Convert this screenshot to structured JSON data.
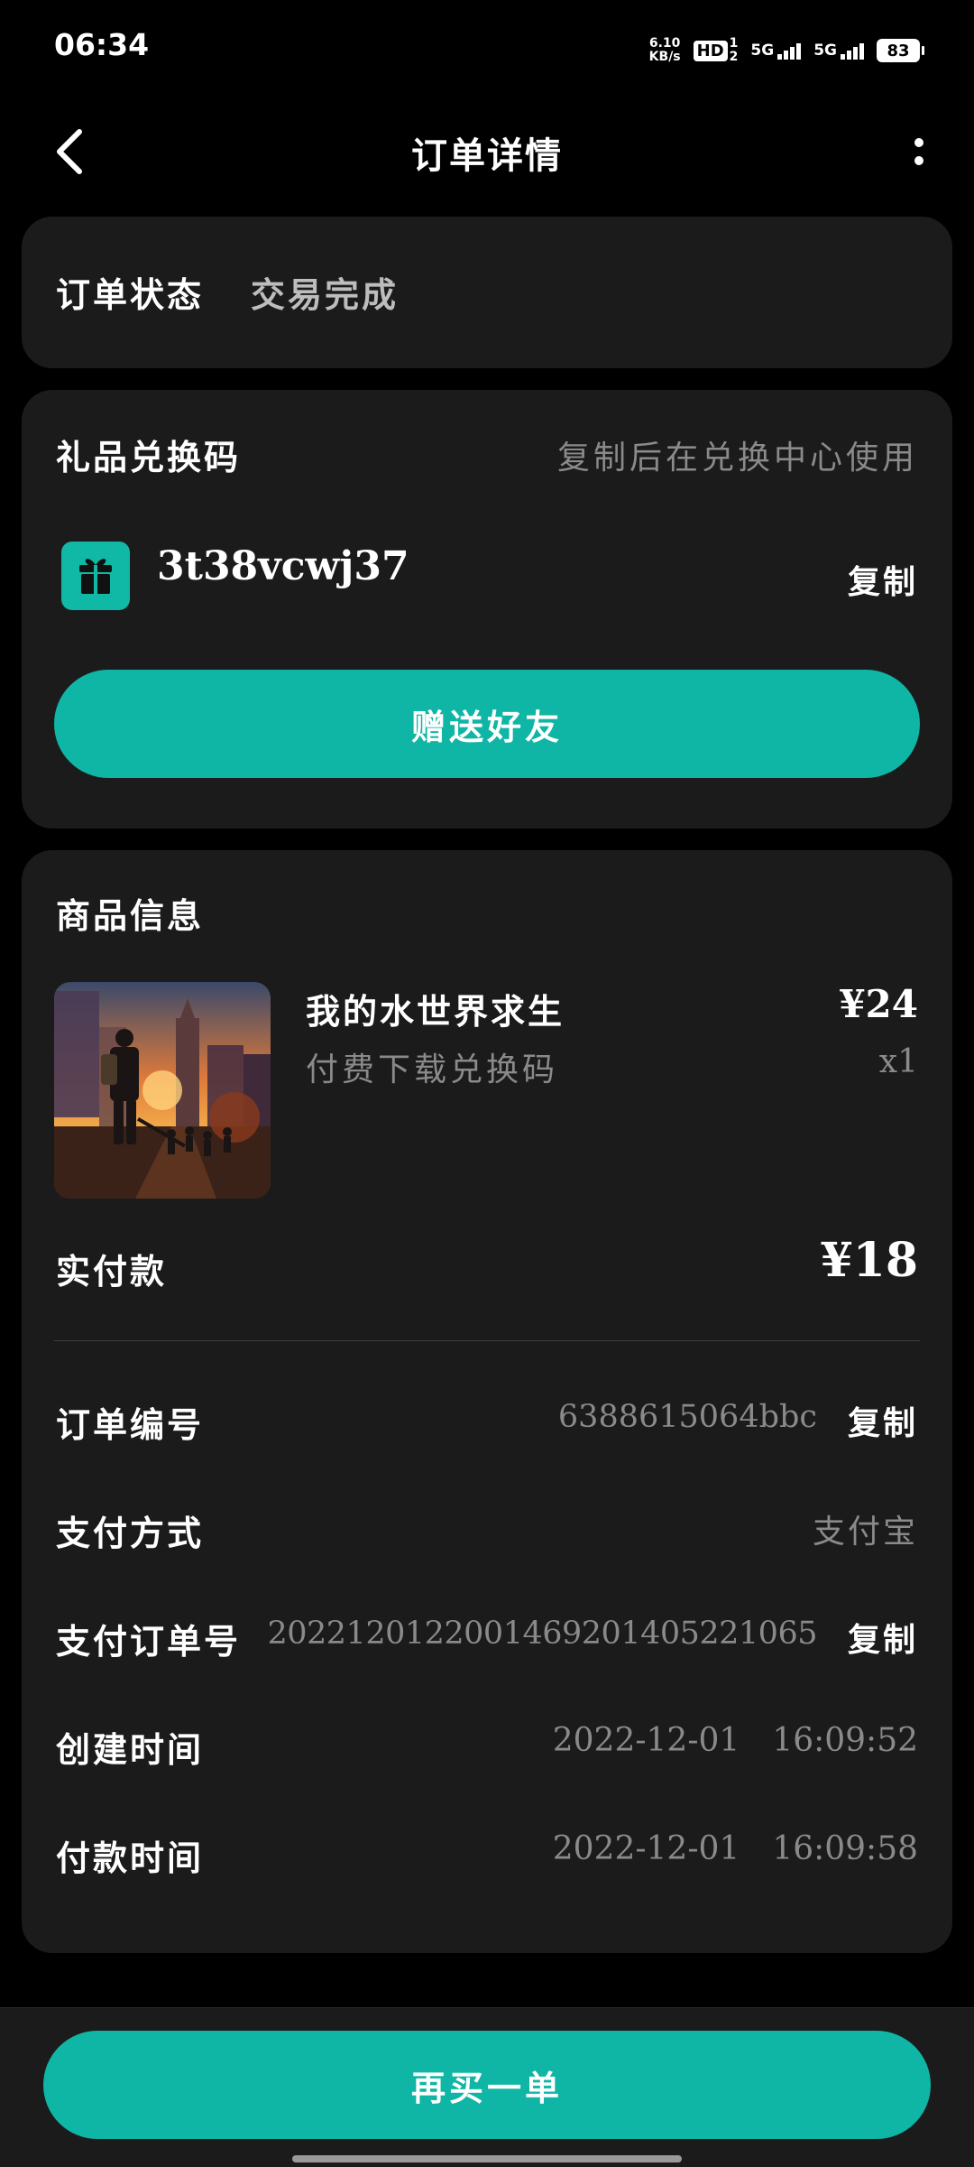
{
  "status_bar": {
    "time": "06:34",
    "net_speed_value": "6.10",
    "net_speed_unit": "KB/s",
    "hd_label": "HD",
    "sim_top": "1",
    "sim_bottom": "2",
    "signal1_label": "5G",
    "signal2_label": "5G",
    "battery": "83"
  },
  "nav": {
    "title": "订单详情",
    "icons": [
      "back-icon",
      "more-vertical-icon"
    ]
  },
  "order_status": {
    "label": "订单状态",
    "value": "交易完成"
  },
  "gift_code": {
    "label": "礼品兑换码",
    "hint": "复制后在兑换中心使用",
    "code": "3t38vcwj37",
    "copy_label": "复制",
    "icon": "gift-icon",
    "gift_button": "赠送好友"
  },
  "product": {
    "section_label": "商品信息",
    "name": "我的水世界求生",
    "subtitle": "付费下载兑换码",
    "price": "¥24",
    "quantity": "x1",
    "paid_label": "实付款",
    "paid_amount": "¥18"
  },
  "details": {
    "order_no_label": "订单编号",
    "order_no": "6388615064bbc",
    "order_no_copy": "复制",
    "pay_method_label": "支付方式",
    "pay_method": "支付宝",
    "pay_order_label": "支付订单号",
    "pay_order_no": "2022120122001469201405221065",
    "pay_order_copy": "复制",
    "created_label": "创建时间",
    "created_date": "2022-12-01",
    "created_time": "16:09:52",
    "paid_time_label": "付款时间",
    "paid_date": "2022-12-01",
    "paid_time": "16:09:58"
  },
  "bottom": {
    "rebuy_button": "再买一单"
  },
  "colors": {
    "accent": "#0fb5a5",
    "card": "#1b1b1b",
    "background": "#000000",
    "secondary_text": "#8a8a8a"
  }
}
